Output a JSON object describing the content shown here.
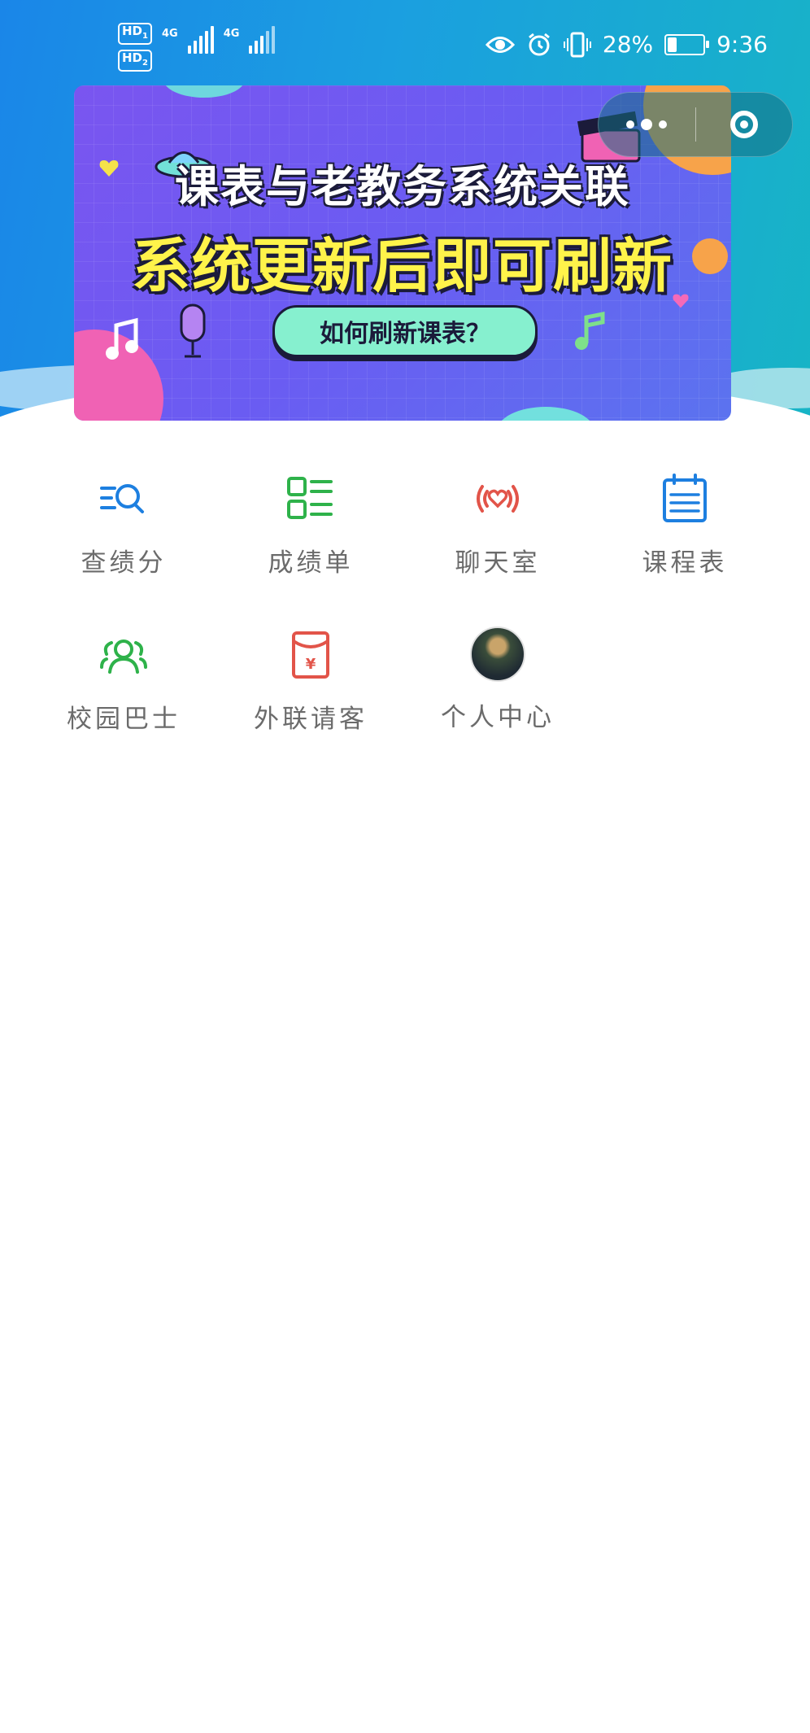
{
  "status_bar": {
    "sim1": "HD",
    "sim1_index": "1",
    "sim2": "HD",
    "sim2_index": "2",
    "network1": "4G",
    "network2": "4G",
    "battery_percent": "28%",
    "battery_level": 0.28,
    "time": "9:36",
    "icons": [
      "eye-comfort-icon",
      "alarm-icon",
      "vibrate-icon",
      "battery-charging-icon"
    ]
  },
  "banner": {
    "title": "课表与老教务系统关联",
    "subtitle": "系统更新后即可刷新",
    "button": "如何刷新课表？"
  },
  "menu": {
    "items": [
      {
        "label": "查绩分",
        "icon": "search-list-icon",
        "color": "#1d7fe0"
      },
      {
        "label": "成绩单",
        "icon": "grid-list-icon",
        "color": "#2eb24a"
      },
      {
        "label": "聊天室",
        "icon": "broadcast-heart-icon",
        "color": "#e25449"
      },
      {
        "label": "课程表",
        "icon": "calendar-icon",
        "color": "#1d7fe0"
      },
      {
        "label": "校园巴士",
        "icon": "users-icon",
        "color": "#2eb24a"
      },
      {
        "label": "外联请客",
        "icon": "red-envelope-icon",
        "color": "#e25449"
      },
      {
        "label": "个人中心",
        "icon": "avatar",
        "color": ""
      }
    ]
  }
}
